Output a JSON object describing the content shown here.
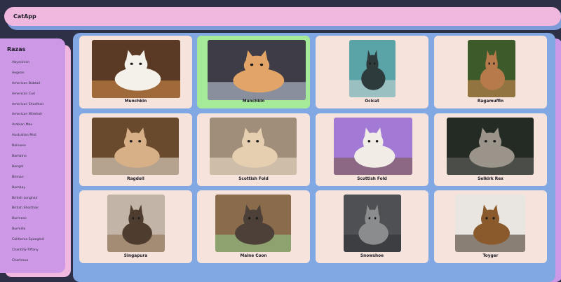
{
  "header": {
    "title": "CatApp"
  },
  "sidebar": {
    "title": "Razas",
    "breeds": [
      "Abyssinian",
      "Aegean",
      "American Bobtail",
      "American Curl",
      "American Shorthair",
      "American Wirehair",
      "Arabian Mau",
      "Australian Mist",
      "Balinese",
      "Bambino",
      "Bengal",
      "Birman",
      "Bombay",
      "British Longhair",
      "British Shorthair",
      "Burmese",
      "Burmilla",
      "California Spangled",
      "Chantilly-Tiffany",
      "Chartreux"
    ]
  },
  "cards": [
    {
      "name": "Munchkin",
      "selected": false,
      "photo_icon": "cat-photo",
      "colors": {
        "bg": "#5a3a24",
        "cat": "#f4f0ea",
        "accent": "#d9904a"
      }
    },
    {
      "name": "Munchkin",
      "selected": true,
      "photo_icon": "cat-photo",
      "colors": {
        "bg": "#3e3c46",
        "cat": "#e3a567",
        "accent": "#c9d4e8"
      }
    },
    {
      "name": "Ocicat",
      "selected": false,
      "photo_icon": "cat-photo",
      "colors": {
        "bg": "#5aa3a6",
        "cat": "#2e3b3c",
        "accent": "#d0d8d8"
      }
    },
    {
      "name": "Ragamuffin",
      "selected": false,
      "photo_icon": "cat-photo",
      "colors": {
        "bg": "#3d5a2a",
        "cat": "#b77a4a",
        "accent": "#d88a52"
      }
    },
    {
      "name": "Ragdoll",
      "selected": false,
      "photo_icon": "cat-photo",
      "colors": {
        "bg": "#6a4a2c",
        "cat": "#d7b088",
        "accent": "#f2ece2"
      }
    },
    {
      "name": "Scottish Fold",
      "selected": false,
      "photo_icon": "cat-photo",
      "colors": {
        "bg": "#a08e7a",
        "cat": "#e6cfb0",
        "accent": "#f3e4cf"
      }
    },
    {
      "name": "Scottish Fold",
      "selected": false,
      "photo_icon": "cat-photo",
      "colors": {
        "bg": "#a27ad6",
        "cat": "#f1ede6",
        "accent": "#7a5a44"
      }
    },
    {
      "name": "Selkirk Rex",
      "selected": false,
      "photo_icon": "cat-photo",
      "colors": {
        "bg": "#242a24",
        "cat": "#9a948a",
        "accent": "#6a6a66"
      }
    },
    {
      "name": "Singapura",
      "selected": false,
      "photo_icon": "cat-photo",
      "colors": {
        "bg": "#c2b4a6",
        "cat": "#4e3c2e",
        "accent": "#8a6a4a"
      }
    },
    {
      "name": "Maine Coon",
      "selected": false,
      "photo_icon": "cat-photo",
      "colors": {
        "bg": "#8a6c4c",
        "cat": "#4c4038",
        "accent": "#8fd08a"
      }
    },
    {
      "name": "Snowshoe",
      "selected": false,
      "photo_icon": "cat-photo",
      "colors": {
        "bg": "#4e5054",
        "cat": "#8a8c8e",
        "accent": "#2e3032"
      }
    },
    {
      "name": "Toyger",
      "selected": false,
      "photo_icon": "cat-photo",
      "colors": {
        "bg": "#e9e6e1",
        "cat": "#8a5a2c",
        "accent": "#3a2a1c"
      }
    }
  ]
}
